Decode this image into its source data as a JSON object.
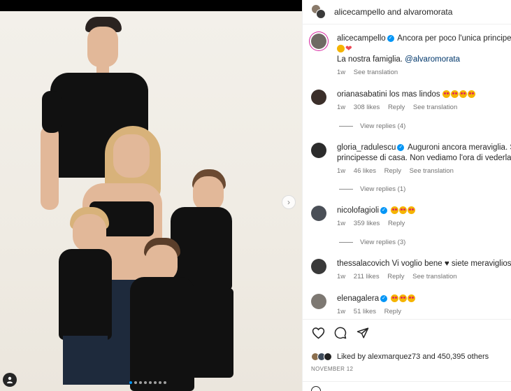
{
  "header": {
    "title": "alicecampello and alvaromorata"
  },
  "photo": {
    "dots_count": 8,
    "active_dot": 0
  },
  "caption": {
    "user": "alicecampello",
    "text": "Ancora per poco l'unica principessa d",
    "line2_suffix": "",
    "line3_prefix": "La nostra famiglia.",
    "mention": "@alvaromorata",
    "time": "1w",
    "see_translation": "See translation"
  },
  "comments": [
    {
      "user": "oriananasabatini",
      "display_user": "orianasabatini",
      "text": "los mas lindos",
      "time": "1w",
      "likes": "308 likes",
      "reply": "Reply",
      "translate": "See translation",
      "view_replies": "View replies (4)"
    },
    {
      "user": "gloria_radulescu",
      "text": "Auguroni ancora meraviglia. Saret",
      "text2": "principesse di casa. Non vediamo l'ora di vederla",
      "time": "1w",
      "likes": "46 likes",
      "reply": "Reply",
      "translate": "See translation",
      "view_replies": "View replies (1)"
    },
    {
      "user": "nicolofagioli",
      "text": "",
      "time": "1w",
      "likes": "359 likes",
      "reply": "Reply",
      "view_replies": "View replies (3)"
    },
    {
      "user": "thessalacovich",
      "text": "Vi voglio bene ♥ siete meravigliosi ♥",
      "time": "1w",
      "likes": "211 likes",
      "reply": "Reply",
      "translate": "See translation"
    },
    {
      "user": "elenagalera",
      "text": "",
      "time": "1w",
      "likes": "51 likes",
      "reply": "Reply"
    }
  ],
  "actions": {
    "liked_by_prefix": "Liked by",
    "liked_by_user": "alexmarquez73",
    "liked_by_suffix": "and 450,395 others",
    "date": "NOVEMBER 12"
  },
  "colors": {
    "verified": "#0095f6",
    "heart": "#ed4956",
    "story_ring": "#d6249f"
  },
  "icons": {
    "like": "heart-icon",
    "comment": "comment-bubble-icon",
    "share": "paper-plane-icon",
    "next": "chevron-right-icon",
    "tag": "user-tag-icon"
  }
}
